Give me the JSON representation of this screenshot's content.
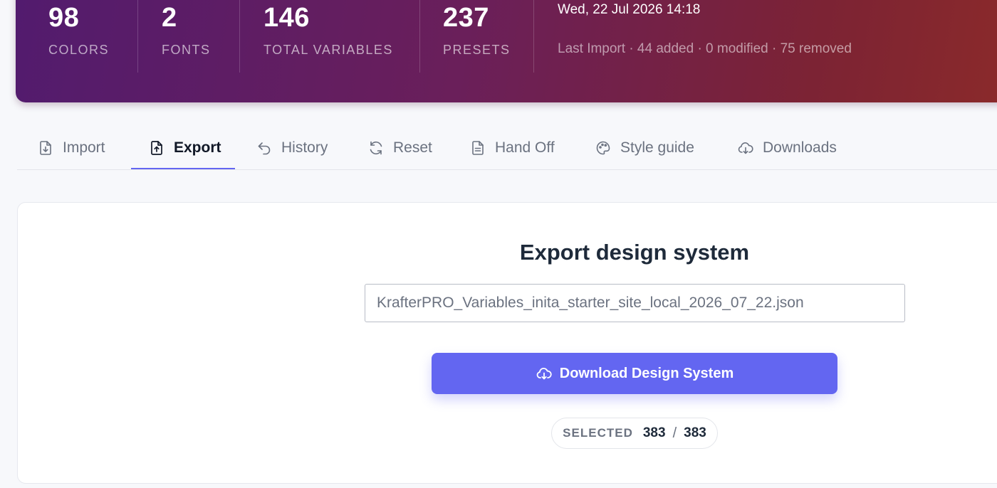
{
  "stats": [
    {
      "value": "98",
      "label": "COLORS"
    },
    {
      "value": "2",
      "label": "FONTS"
    },
    {
      "value": "146",
      "label": "TOTAL VARIABLES"
    },
    {
      "value": "237",
      "label": "PRESETS"
    }
  ],
  "meta": {
    "datetime": "Wed, 22 Jul 2026 14:18",
    "last_import": "Last Import · 44 added · 0 modified · 75 removed"
  },
  "tabs": [
    {
      "label": "Import",
      "icon": "file-import-icon"
    },
    {
      "label": "Export",
      "icon": "file-export-icon",
      "active": true
    },
    {
      "label": "History",
      "icon": "undo-arrow-icon"
    },
    {
      "label": "Reset",
      "icon": "refresh-icon"
    },
    {
      "label": "Hand Off",
      "icon": "document-icon"
    },
    {
      "label": "Style guide",
      "icon": "palette-icon"
    },
    {
      "label": "Downloads",
      "icon": "cloud-download-icon"
    }
  ],
  "export": {
    "title": "Export design system",
    "filename": "KrafterPRO_Variables_inita_starter_site_local_2026_07_22.json",
    "download_label": "Download Design System",
    "selected_label": "SELECTED",
    "selected_count": "383",
    "selected_separator": "/",
    "total_count": "383"
  },
  "colors": {
    "accent": "#6366f1",
    "banner_start": "#521b6e",
    "banner_end": "#8b2a2a"
  }
}
